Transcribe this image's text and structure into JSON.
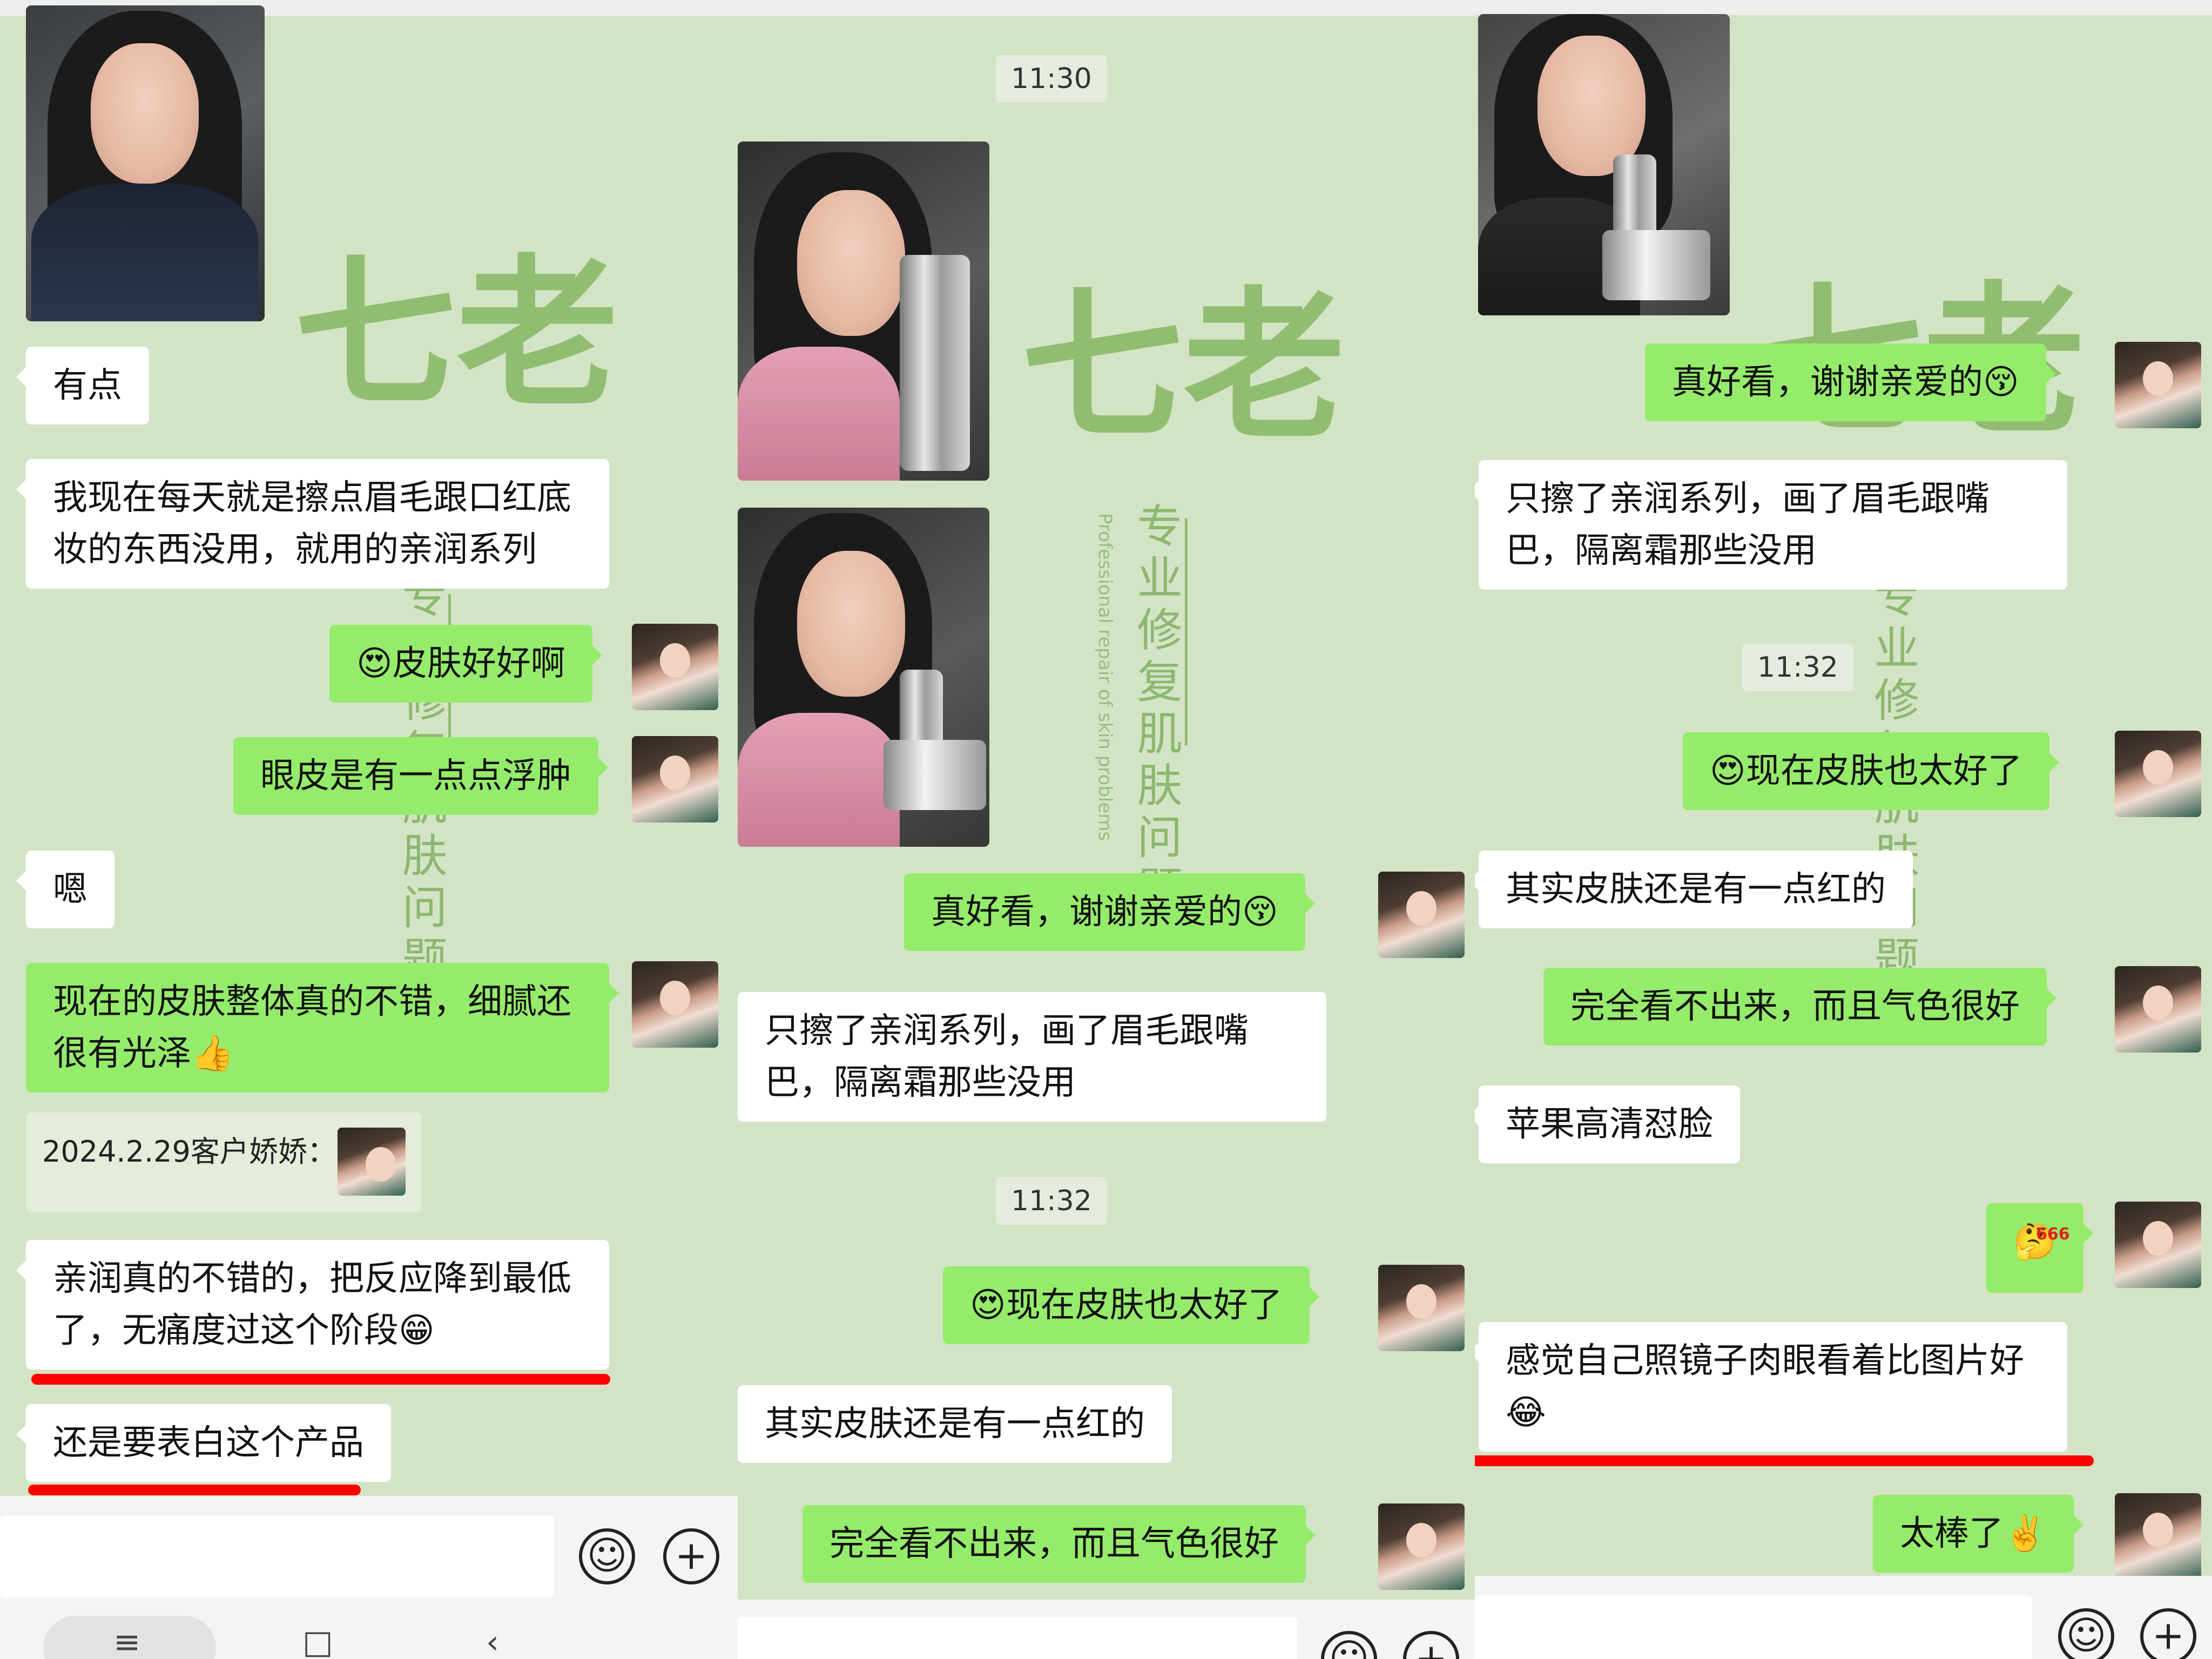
{
  "watermark": {
    "logo": "七老",
    "vertical_text": "专业修复肌肤问题",
    "english_text": "Professional repair of skin problems"
  },
  "panel1": {
    "messages": {
      "m1": "有点",
      "m2": "我现在每天就是擦点眉毛跟口红底妆的东西没用，就用的亲润系列",
      "m3": "😍皮肤好好啊",
      "m4": "眼皮是有一点点浮肿",
      "m5": "嗯",
      "m6": "现在的皮肤整体真的不错，细腻还很有光泽👍",
      "m7": "亲润真的不错的，把反应降到最低了，无痛度过这个阶段😁",
      "m8": "还是要表白这个产品"
    },
    "quote_label": "2024.2.29客户娇娇："
  },
  "panel2": {
    "time1": "11:30",
    "time2": "11:32",
    "messages": {
      "m1": "真好看，谢谢亲爱的😚",
      "m2": "只擦了亲润系列，画了眉毛跟嘴巴，隔离霜那些没用",
      "m3": "😍现在皮肤也太好了",
      "m4": "其实皮肤还是有一点红的",
      "m5": "完全看不出来，而且气色很好"
    }
  },
  "panel3": {
    "time1": "11:32",
    "messages": {
      "m1": "真好看，谢谢亲爱的😚",
      "m2": "只擦了亲润系列，画了眉毛跟嘴巴，隔离霜那些没用",
      "m3": "😍现在皮肤也太好了",
      "m4": "其实皮肤还是有一点红的",
      "m5": "完全看不出来，而且气色很好",
      "m6": "苹果高清怼脸",
      "m7": "🤔",
      "m8": "感觉自己照镜子肉眼看着比图片好😂",
      "m9": "太棒了✌️"
    },
    "sticker_badge": "666"
  },
  "input_bar": {
    "emoji_icon": "smiley-face-icon",
    "plus_icon": "plus-circle-icon"
  },
  "colors": {
    "chat_background": "#d3e4c6",
    "outgoing_bubble": "#95ec6a",
    "incoming_bubble": "#ffffff",
    "highlight_underline": "#ff0000"
  }
}
